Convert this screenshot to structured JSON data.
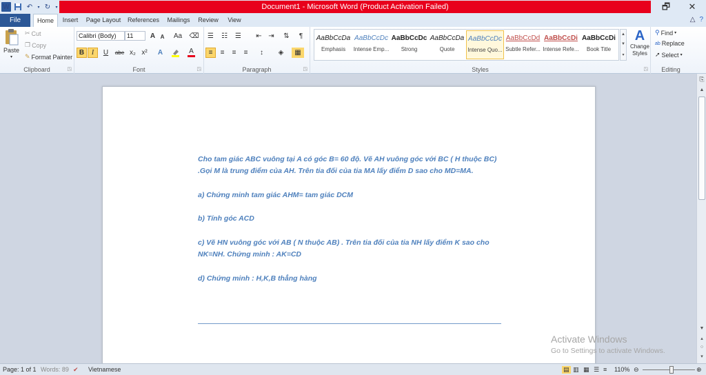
{
  "titlebar": {
    "title": "Document1 - Microsoft Word (Product Activation Failed)",
    "app_icon": "W",
    "restore_glyph": "🗗",
    "close_glyph": "✕"
  },
  "tabs": {
    "file": "File",
    "items": [
      "Home",
      "Insert",
      "Page Layout",
      "References",
      "Mailings",
      "Review",
      "View"
    ]
  },
  "ribbon": {
    "clipboard": {
      "label": "Clipboard",
      "paste": "Paste",
      "cut": "Cut",
      "copy": "Copy",
      "format_painter": "Format Painter"
    },
    "font": {
      "label": "Font",
      "font_name": "Calibri (Body)",
      "font_size": "11",
      "grow": "A",
      "shrink": "A",
      "change_case": "Aa",
      "bold": "B",
      "italic": "I",
      "underline": "U",
      "strike": "abe",
      "subscript": "x₂",
      "superscript": "x²"
    },
    "paragraph": {
      "label": "Paragraph",
      "show_marks": "¶"
    },
    "styles": {
      "label": "Styles",
      "items": [
        {
          "sample": "AaBbCcDa",
          "name": "Emphasis",
          "color": "#222222"
        },
        {
          "sample": "AaBbCcDc",
          "name": "Intense Emp...",
          "color": "#4f81bd"
        },
        {
          "sample": "AaBbCcDc",
          "name": "Strong",
          "color": "#222222"
        },
        {
          "sample": "AaBbCcDa",
          "name": "Quote",
          "color": "#222222"
        },
        {
          "sample": "AaBbCcDc",
          "name": "Intense Quo...",
          "color": "#4f81bd"
        },
        {
          "sample": "AaBbCcDd",
          "name": "Subtle Refer...",
          "color": "#c0504d"
        },
        {
          "sample": "AaBbCcDi",
          "name": "Intense Refe...",
          "color": "#c0504d"
        },
        {
          "sample": "AaBbCcDi",
          "name": "Book Title",
          "color": "#222222"
        }
      ],
      "selected_index": 4,
      "change_styles": "Change Styles"
    },
    "editing": {
      "label": "Editing",
      "find": "Find",
      "replace": "Replace",
      "select": "Select"
    }
  },
  "document": {
    "paragraphs": [
      "Cho tam giác ABC vuông tại A có góc B= 60 độ. Vẽ AH vuông góc với BC ( H thuộc BC) .Gọi M là trung điểm của AH. Trên tia đối của tia MA lấy điểm D sao cho MD=MA.",
      "a) Chứng minh tam giác AHM= tam giác DCM",
      "b) Tính góc ACD",
      "c) Vẽ HN vuông góc với AB ( N thuộc AB) . Trên tia đối của tia NH lấy điểm K sao cho NK=NH. Chứng minh : AK=CD",
      "d) Chứng minh : H,K,B thẳng hàng"
    ]
  },
  "watermark": {
    "line1": "Activate Windows",
    "line2": "Go to Settings to activate Windows."
  },
  "statusbar": {
    "page": "Page: 1 of 1",
    "words": "Words: 89",
    "language": "Vietnamese",
    "zoom": "110%",
    "zoom_fraction": 0.55
  }
}
